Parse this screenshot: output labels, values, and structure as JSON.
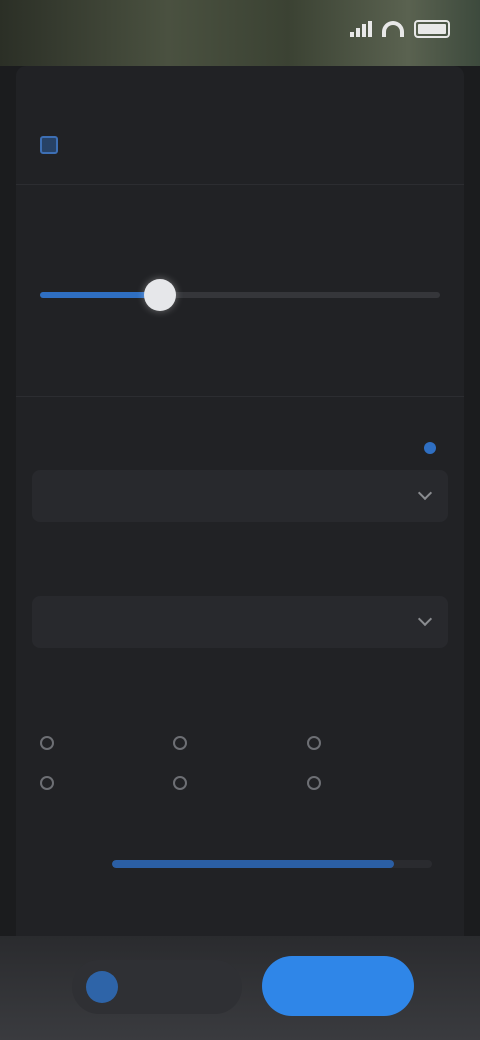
{
  "status": {
    "time": ""
  },
  "sections": {
    "header": "",
    "check_label": "",
    "level_title": "",
    "level_ticks": [
      "",
      "",
      "",
      "",
      ""
    ],
    "level_value": 0.3,
    "source_title": "",
    "source_value": "",
    "format_title": "",
    "format_value": "",
    "options_title": "",
    "options": [
      "",
      "",
      "",
      "",
      "",
      ""
    ],
    "progress_label": "",
    "progress_value": 0.88,
    "secondary_label": ""
  },
  "footer": {
    "secondary_button": "",
    "primary_button": ""
  },
  "colors": {
    "accent": "#2f86e8",
    "track_fill": "#2f6fc2"
  }
}
